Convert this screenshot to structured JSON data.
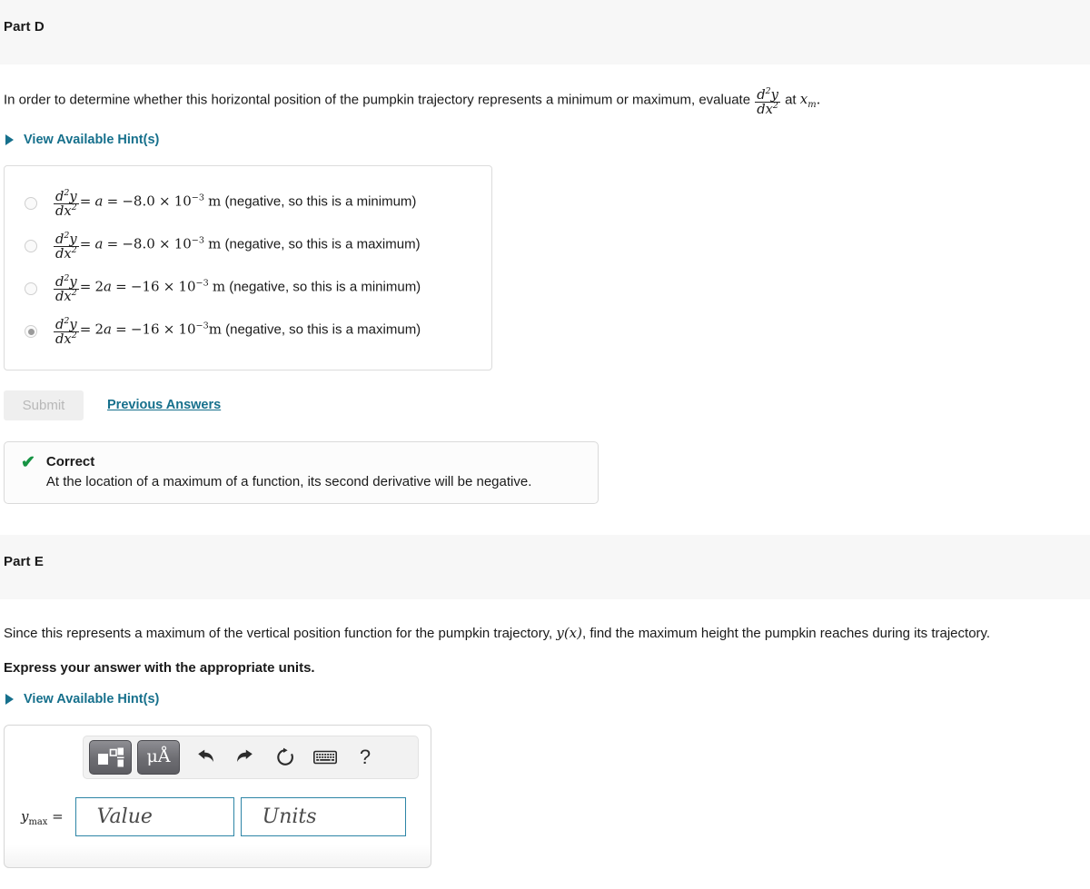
{
  "part_d": {
    "title": "Part D",
    "question_prefix": "In order to determine whether this horizontal position of the pumpkin trajectory represents a minimum or maximum, evaluate",
    "question_suffix": "at",
    "math_dd": "d²y/dx²",
    "math_xm": "x_m",
    "period": ".",
    "hint_label": "View Available Hint(s)",
    "choices": [
      {
        "id": "choice-1",
        "selected": false,
        "lhs": "d²y/dx²",
        "eq1": "=",
        "coef": "a",
        "eq2": "=",
        "value": "−8.0",
        "times": "×",
        "base": "10",
        "exp": "−3",
        "unit": "m",
        "note": "(negative, so this is a minimum)"
      },
      {
        "id": "choice-2",
        "selected": false,
        "lhs": "d²y/dx²",
        "eq1": "=",
        "coef": "a",
        "eq2": "=",
        "value": "−8.0",
        "times": "×",
        "base": "10",
        "exp": "−3",
        "unit": "m",
        "note": "(negative, so this is a maximum)"
      },
      {
        "id": "choice-3",
        "selected": false,
        "lhs": "d²y/dx²",
        "eq1": "=",
        "coef": "2a",
        "eq2": "=",
        "value": "−16",
        "times": "×",
        "base": "10",
        "exp": "−3",
        "unit": "m",
        "note": "(negative, so this is a minimum)"
      },
      {
        "id": "choice-4",
        "selected": true,
        "lhs": "d²y/dx²",
        "eq1": "=",
        "coef": "2a",
        "eq2": "=",
        "value": "−16",
        "times": "×",
        "base": "10",
        "exp": "−3",
        "unit": "m",
        "note": "(negative, so this is a maximum)"
      }
    ],
    "submit_label": "Submit",
    "previous_answers_label": "Previous Answers",
    "feedback": {
      "status": "Correct",
      "icon": "check-icon",
      "text": "At the location of a maximum of a function, its second derivative will be negative."
    }
  },
  "part_e": {
    "title": "Part E",
    "question_part1": "Since this represents a maximum of the vertical position function for the pumpkin trajectory,",
    "question_math": "y(x)",
    "question_part2": ", find the maximum height the pumpkin reaches during its trajectory.",
    "instruction": "Express your answer with the appropriate units.",
    "hint_label": "View Available Hint(s)",
    "toolbar": [
      {
        "name": "math-template-button",
        "label": ""
      },
      {
        "name": "units-button",
        "label": "μÅ"
      },
      {
        "name": "undo-button",
        "label": ""
      },
      {
        "name": "redo-button",
        "label": ""
      },
      {
        "name": "reset-button",
        "label": ""
      },
      {
        "name": "keyboard-button",
        "label": ""
      },
      {
        "name": "help-button",
        "label": "?"
      }
    ],
    "answer": {
      "label_y": "y",
      "label_sub": "max",
      "label_eq": "=",
      "value_placeholder": "Value",
      "value_text": "",
      "units_placeholder": "Units",
      "units_text": ""
    }
  },
  "colors": {
    "link": "#16708c",
    "correct": "#179444",
    "field_border": "#2d85a6",
    "header_bg": "#f7f7f7"
  }
}
